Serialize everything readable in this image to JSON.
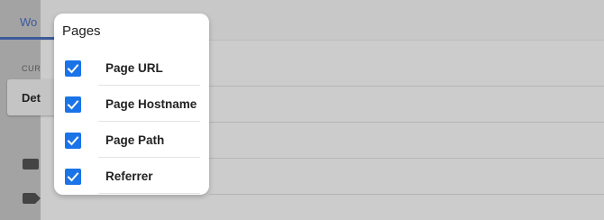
{
  "background": {
    "tab_label": "Wo",
    "section_label": "CUR",
    "card_label": "Det"
  },
  "panel": {
    "title": "Pages",
    "items": [
      {
        "label": "Page URL",
        "checked": true
      },
      {
        "label": "Page Hostname",
        "checked": true
      },
      {
        "label": "Page Path",
        "checked": true
      },
      {
        "label": "Referrer",
        "checked": true
      }
    ]
  },
  "colors": {
    "checkbox": "#1a73e8",
    "overlay": "#cccccc"
  }
}
